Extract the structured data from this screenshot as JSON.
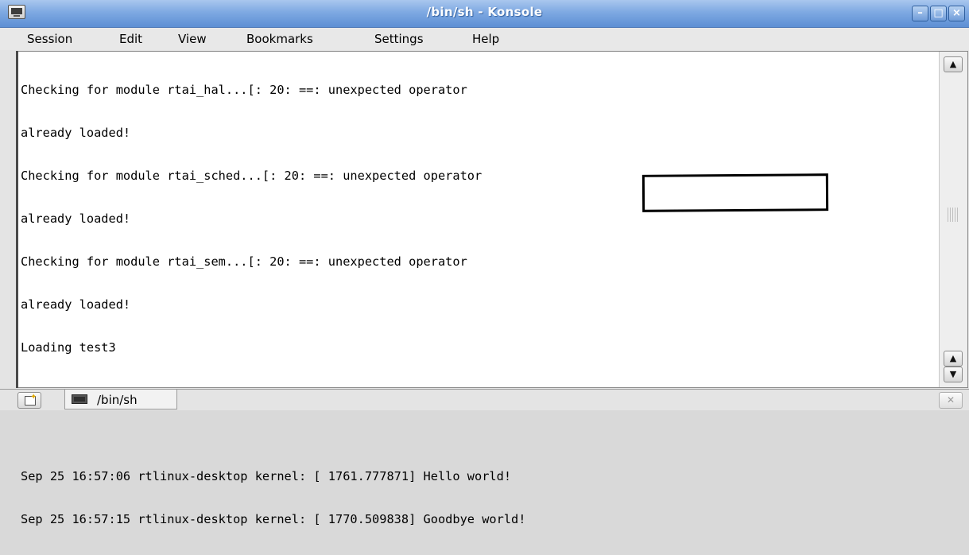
{
  "window": {
    "title": "/bin/sh - Konsole",
    "controls": {
      "minimize": "–",
      "maximize": "□",
      "close": "×"
    }
  },
  "menu": {
    "items": [
      "Session",
      "Edit",
      "View",
      "Bookmarks",
      "Settings",
      "Help"
    ]
  },
  "terminal": {
    "lines": [
      "Checking for module rtai_hal...[: 20: ==: unexpected operator",
      "already loaded!",
      "Checking for module rtai_sched...[: 20: ==: unexpected operator",
      "already loaded!",
      "Checking for module rtai_sem...[: 20: ==: unexpected operator",
      "already loaded!",
      "Loading test3",
      "",
      "",
      "Sep 25 16:57:06 rtlinux-desktop kernel: [ 1761.777871] Hello world!",
      "Sep 25 16:57:15 rtlinux-desktop kernel: [ 1770.509838] Goodbye world!"
    ]
  },
  "scrollbar": {
    "up_arrow": "▲",
    "down_arrow": "▼"
  },
  "tabs": {
    "items": [
      {
        "label": "/bin/sh",
        "icon": "terminal-icon"
      }
    ],
    "new_tab_icon": "new-session-icon",
    "close_tab_icon": "close-session-icon"
  }
}
